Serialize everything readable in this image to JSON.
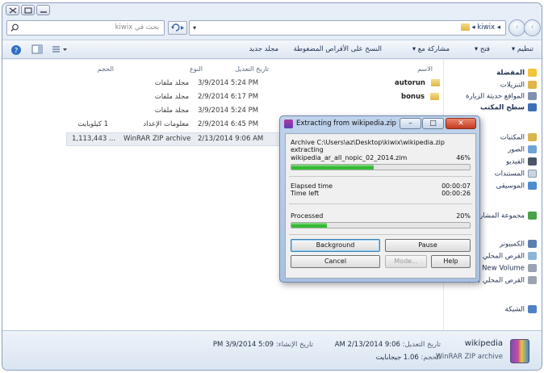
{
  "window": {
    "search_placeholder": "بحث في kiwix",
    "address_crumb": "◂ kiwix ◂"
  },
  "commandbar": {
    "organize": "تنظيم ▾",
    "open": "فتح ▾",
    "share": "مشاركة مع ▾",
    "burn": "النسخ على الأقراص المضغوطة",
    "new_folder": "مجلد جديد"
  },
  "sidebar": {
    "favorites": "المفضلة",
    "downloads": "التنزيلات",
    "recent": "المواقع حديثة الزيارة",
    "desktop": "سطح المكتب",
    "libraries": "المكتبات",
    "pictures": "الصور",
    "videos": "الفيديو",
    "documents": "المستندات",
    "music": "الموسيقى",
    "homegroup": "مجموعة المشاركة المنزلية",
    "computer": "الكمبيوتر",
    "local_disk": "القرص المحلي",
    "new_volume": "New Volume",
    "local_disk_g": "القرص المحلي (G:)",
    "network": "الشبكة"
  },
  "columns": {
    "name": "الاسم",
    "date": "تاريخ التعديل",
    "type": "النوع",
    "size": "الحجم"
  },
  "files": [
    {
      "name": "autorun",
      "date": "3/9/2014 5:24 PM",
      "type": "مجلد ملفات",
      "size": ""
    },
    {
      "name": "bonus",
      "date": "2/9/2014 6:17 PM",
      "type": "مجلد ملفات",
      "size": ""
    },
    {
      "name": "",
      "date": "3/9/2014 5:24 PM",
      "type": "مجلد ملفات",
      "size": ""
    },
    {
      "name": "",
      "date": "2/9/2014 6:45 PM",
      "type": "معلومات الإعداد",
      "size": "1 كيلوبايت"
    },
    {
      "name": "",
      "date": "2/13/2014 9:06 AM",
      "type": "WinRAR ZIP archive",
      "size": "1,113,443 ..."
    }
  ],
  "dialog": {
    "title": "Extracting from wikipedia.zip",
    "archive": "Archive C:\\Users\\az\\Desktop\\kiwix\\wikipedia.zip",
    "status": "extracting",
    "current_file": "wikipedia_ar_all_nopic_02_2014.zim",
    "file_percent": "46%",
    "file_progress": 0.46,
    "elapsed_label": "Elapsed time",
    "elapsed_value": "00:00:07",
    "left_label": "Time left",
    "left_value": "00:00:26",
    "processed_label": "Processed",
    "processed_percent": "20%",
    "processed_progress": 0.2,
    "btn_background": "Background",
    "btn_pause": "Pause",
    "btn_cancel": "Cancel",
    "btn_mode": "Mode...",
    "btn_help": "Help"
  },
  "details": {
    "name": "wikipedia",
    "type": "WinRAR ZIP archive",
    "modified_label": "تاريخ التعديل:",
    "modified_value": "9:06 AM 2/13/2014",
    "size_label": "الحجم:",
    "size_value": "1.06 جيجابايت",
    "created_label": "تاريخ الإنشاء:",
    "created_value": "5:09 PM 3/9/2014"
  }
}
